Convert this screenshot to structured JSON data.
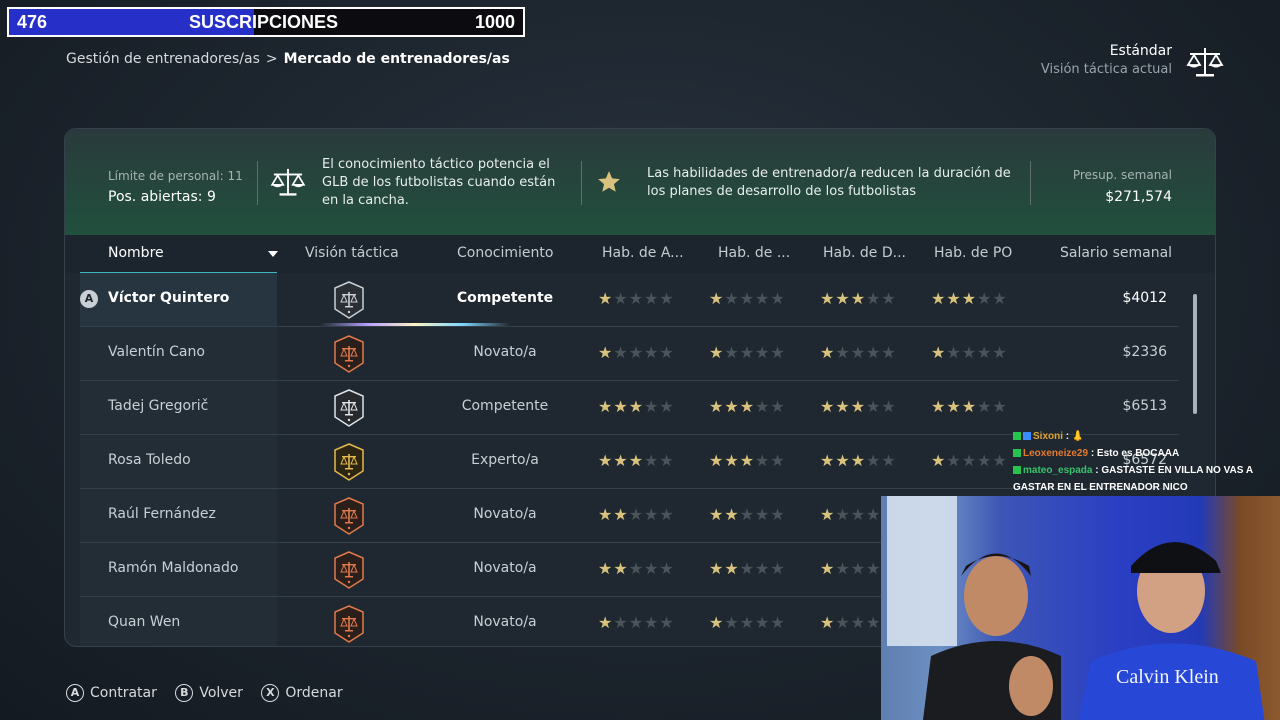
{
  "stream": {
    "sub_count": "476",
    "sub_title": "SUSCRIPCIONES",
    "sub_goal": "1000",
    "sub_progress": 0.476,
    "chat": [
      {
        "user": "Sixoni",
        "msg": ": 👃"
      },
      {
        "user": "Leoxeneize29",
        "msg": ": Esto es BOCAAA"
      },
      {
        "user": "mateo_espada",
        "msg": ": GASTASTE EN VILLA NO VAS A GASTAR EN EL ENTRENADOR NICO"
      }
    ],
    "webcam_shirt_text": "Calvin Klein"
  },
  "breadcrumb": {
    "parent": "Gestión de entrenadores/as",
    "current": "Mercado de entrenadores/as"
  },
  "tactic": {
    "name": "Estándar",
    "label": "Visión táctica actual"
  },
  "info": {
    "staff_limit": "Límite de personal: 11",
    "open_positions": "Pos. abiertas: 9",
    "tactic_note": "El conocimiento táctico potencia el GLB de los futbolistas cuando están en la cancha.",
    "skills_note": "Las habilidades de entrenador/a reducen la duración de los planes de desarrollo de los futbolistas",
    "budget_label": "Presup. semanal",
    "budget_value": "$271,574"
  },
  "table": {
    "headers": [
      "Nombre",
      "Visión táctica",
      "Conocimiento",
      "Hab. de A...",
      "Hab. de ...",
      "Hab. de D...",
      "Hab. de PO",
      "Salario semanal"
    ],
    "rows": [
      {
        "name": "Víctor Quintero",
        "badge": "dark",
        "knowledge": "Competente",
        "stars": [
          1,
          1,
          3,
          3
        ],
        "salary": "$4012",
        "selected": true
      },
      {
        "name": "Valentín Cano",
        "badge": "bronze",
        "knowledge": "Novato/a",
        "stars": [
          1,
          1,
          1,
          1
        ],
        "salary": "$2336"
      },
      {
        "name": "Tadej Gregorič",
        "badge": "silver",
        "knowledge": "Competente",
        "stars": [
          3,
          3,
          3,
          3
        ],
        "salary": "$6513"
      },
      {
        "name": "Rosa Toledo",
        "badge": "gold",
        "knowledge": "Experto/a",
        "stars": [
          3,
          3,
          3,
          1
        ],
        "salary": "$6572"
      },
      {
        "name": "Raúl Fernández",
        "badge": "bronze",
        "knowledge": "Novato/a",
        "stars": [
          2,
          2,
          1,
          0
        ],
        "salary": ""
      },
      {
        "name": "Ramón Maldonado",
        "badge": "bronze",
        "knowledge": "Novato/a",
        "stars": [
          2,
          2,
          1,
          0
        ],
        "salary": ""
      },
      {
        "name": "Quan Wen",
        "badge": "bronze",
        "knowledge": "Novato/a",
        "stars": [
          1,
          1,
          1,
          0
        ],
        "salary": ""
      }
    ]
  },
  "footer": {
    "hire_btn": "A",
    "hire": "Contratar",
    "back_btn": "B",
    "back": "Volver",
    "sort_btn": "X",
    "sort": "Ordenar"
  },
  "colors": {
    "accent_teal": "#3fb7c3",
    "star_gold": "#d9c27d",
    "sub_bar": "#2630c9"
  }
}
